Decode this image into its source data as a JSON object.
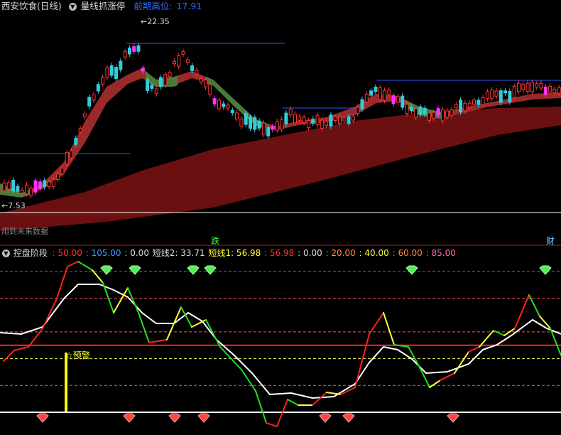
{
  "top_bar": {
    "stock_name": "西安饮食(日线)",
    "indicator_name": "量线抓涨停",
    "prev_high_label": "前期高位:",
    "prev_high_value": "17.91"
  },
  "price_panel": {
    "high_label": "22.35",
    "low_label": "7.53",
    "bottom_text": "用到未来数据",
    "bottom_tags": [
      {
        "text": "跌",
        "color": "#33ff33"
      },
      {
        "text": "财",
        "color": "#66ccff"
      }
    ],
    "colors": {
      "up_candle": "#ff3333",
      "down_candle": "#33ccdd",
      "magenta_candle": "#ff33ff",
      "ribbon_red": "#8b1a1a",
      "ribbon_green": "#4a7a3a",
      "long_band": "#6b1010",
      "blue_line": "#3355ff"
    }
  },
  "indicator_bar": {
    "name": "控盘阶段",
    "items": [
      {
        "text": ": 50.00",
        "color": "#ff3333"
      },
      {
        "text": ": 105.00",
        "color": "#4499ff"
      },
      {
        "text": ": 0.00",
        "color": "#dddddd"
      },
      {
        "text": "短线2: 33.71",
        "color": "#dddddd"
      },
      {
        "text": "短线1: 56.98",
        "color": "#ffff33"
      },
      {
        "text": ": 56.98",
        "color": "#ff3333"
      },
      {
        "text": ": 0.00",
        "color": "#dddddd"
      },
      {
        "text": ": 20.00",
        "color": "#ff8844"
      },
      {
        "text": ": 40.00",
        "color": "#ffff33"
      },
      {
        "text": ": 60.00",
        "color": "#ff8844"
      },
      {
        "text": ": 85.00",
        "color": "#ff66aa"
      }
    ]
  },
  "indicator_panel": {
    "warning_label": "☆预警",
    "levels": [
      105,
      85,
      60,
      50,
      40,
      20,
      0
    ],
    "level_colors": {
      "105": "#4477ff",
      "85": "#ff5555",
      "60": "#ff5555",
      "50": "#ff2222",
      "40": "#ffff55",
      "20": "#ff5555",
      "0": "#ffffff"
    }
  }
}
